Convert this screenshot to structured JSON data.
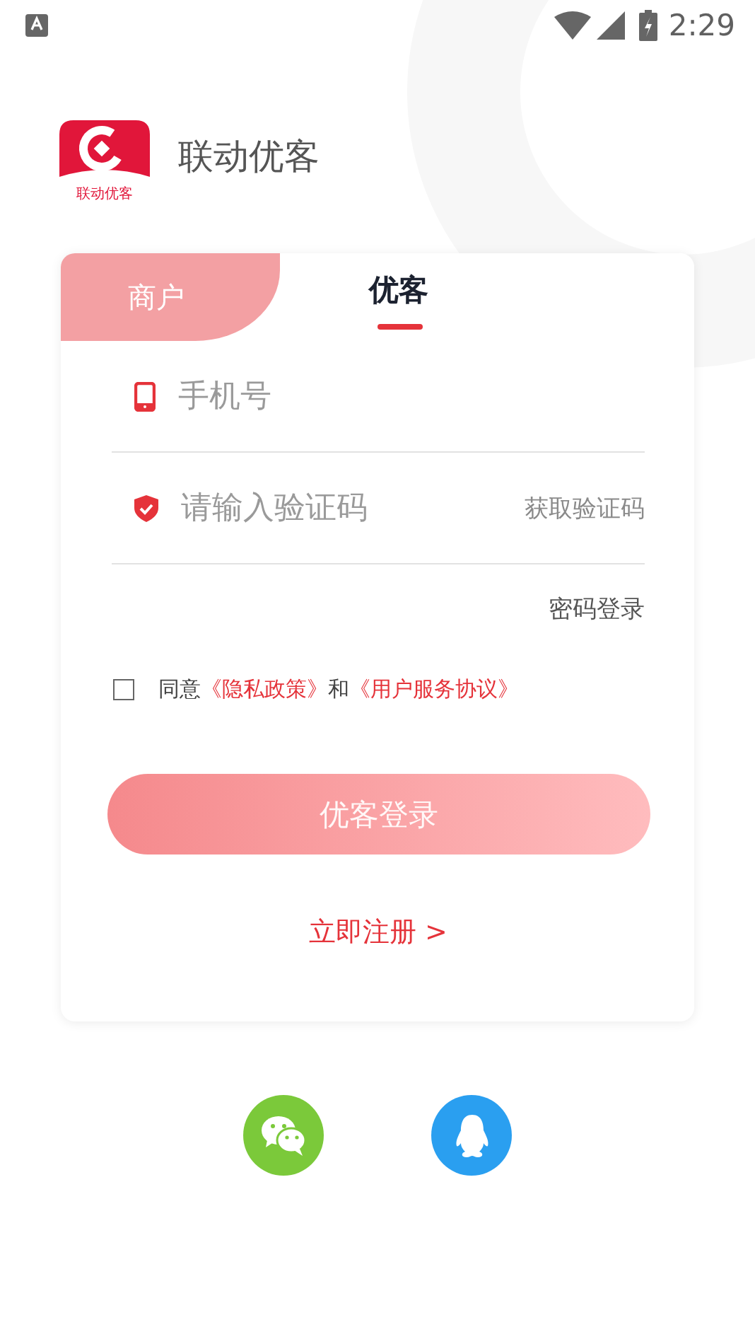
{
  "status_bar": {
    "time": "2:29"
  },
  "brand": {
    "logo_caption": "联动优客",
    "app_name": "联动优客"
  },
  "tabs": [
    {
      "label": "商户",
      "selected": false
    },
    {
      "label": "优客",
      "selected": true
    }
  ],
  "phone_field": {
    "placeholder": "手机号"
  },
  "code_field": {
    "placeholder": "请输入验证码",
    "action": "获取验证码"
  },
  "password_login": "密码登录",
  "agreement": {
    "checked": false,
    "parts": [
      {
        "kind": "text",
        "text": "同意"
      },
      {
        "kind": "link",
        "text": "《隐私政策》"
      },
      {
        "kind": "text",
        "text": "和"
      },
      {
        "kind": "link",
        "text": "《用户服务协议》"
      }
    ]
  },
  "login_button": {
    "label": "优客登录",
    "disabled": true
  },
  "register_link": "立即注册 >",
  "social": [
    {
      "kind": "wechat"
    },
    {
      "kind": "qq"
    }
  ]
}
